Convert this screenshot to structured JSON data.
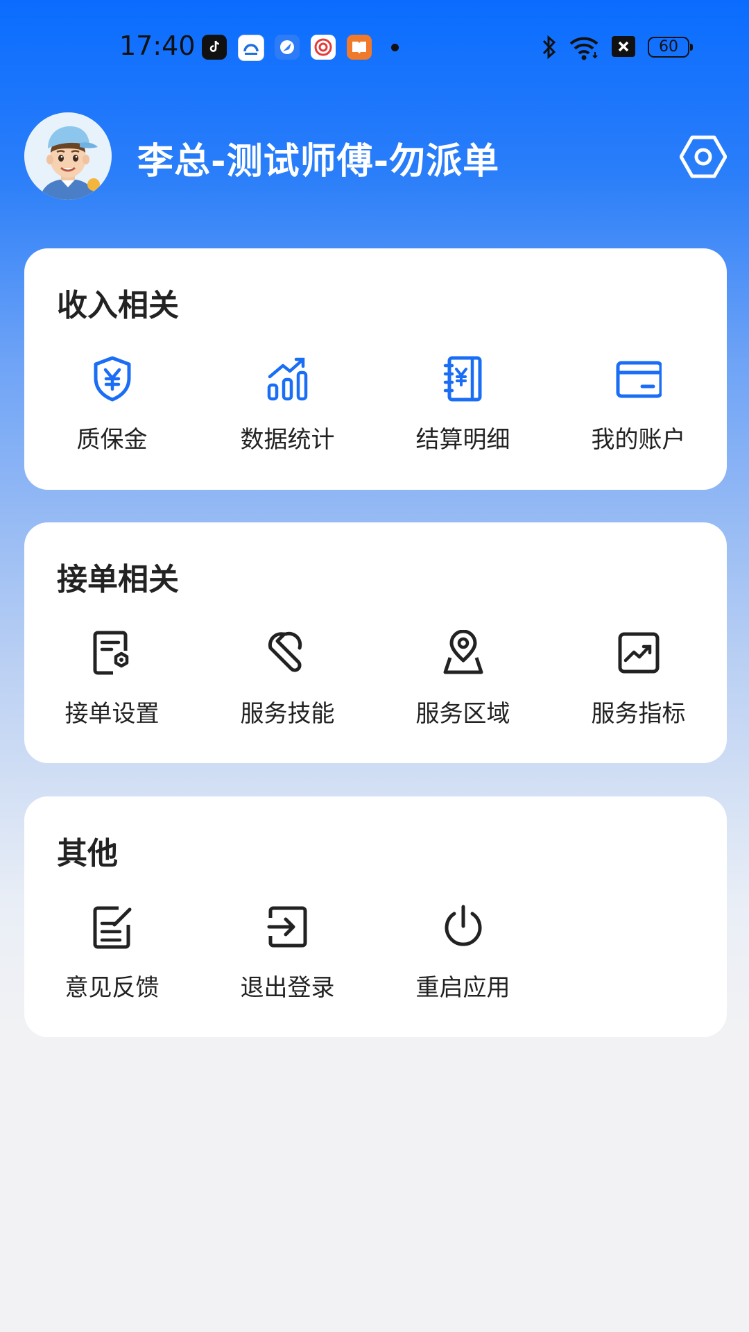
{
  "status_bar": {
    "time": "17:40",
    "battery": "60",
    "apps": [
      "tiktok-icon",
      "map-app-icon",
      "browser-app-icon",
      "news-app-icon",
      "books-app-icon"
    ],
    "indicators": [
      "bluetooth-icon",
      "wifi-icon",
      "sim-off-icon",
      "battery-icon"
    ]
  },
  "header": {
    "username": "李总-测试师傅-勿派单",
    "settings_icon": "settings-icon"
  },
  "sections": [
    {
      "title": "收入相关",
      "items": [
        {
          "label": "质保金",
          "icon": "shield-yen-icon"
        },
        {
          "label": "数据统计",
          "icon": "bar-chart-icon"
        },
        {
          "label": "结算明细",
          "icon": "ledger-icon"
        },
        {
          "label": "我的账户",
          "icon": "card-icon"
        }
      ]
    },
    {
      "title": "接单相关",
      "items": [
        {
          "label": "接单设置",
          "icon": "order-settings-icon"
        },
        {
          "label": "服务技能",
          "icon": "wrench-icon"
        },
        {
          "label": "服务区域",
          "icon": "location-icon"
        },
        {
          "label": "服务指标",
          "icon": "trend-icon"
        }
      ]
    },
    {
      "title": "其他",
      "items": [
        {
          "label": "意见反馈",
          "icon": "feedback-icon"
        },
        {
          "label": "退出登录",
          "icon": "logout-icon"
        },
        {
          "label": "重启应用",
          "icon": "power-icon"
        }
      ]
    }
  ],
  "colors": {
    "accent": "#1a6ef5",
    "icon_dark": "#222222",
    "card_bg": "#ffffff"
  }
}
